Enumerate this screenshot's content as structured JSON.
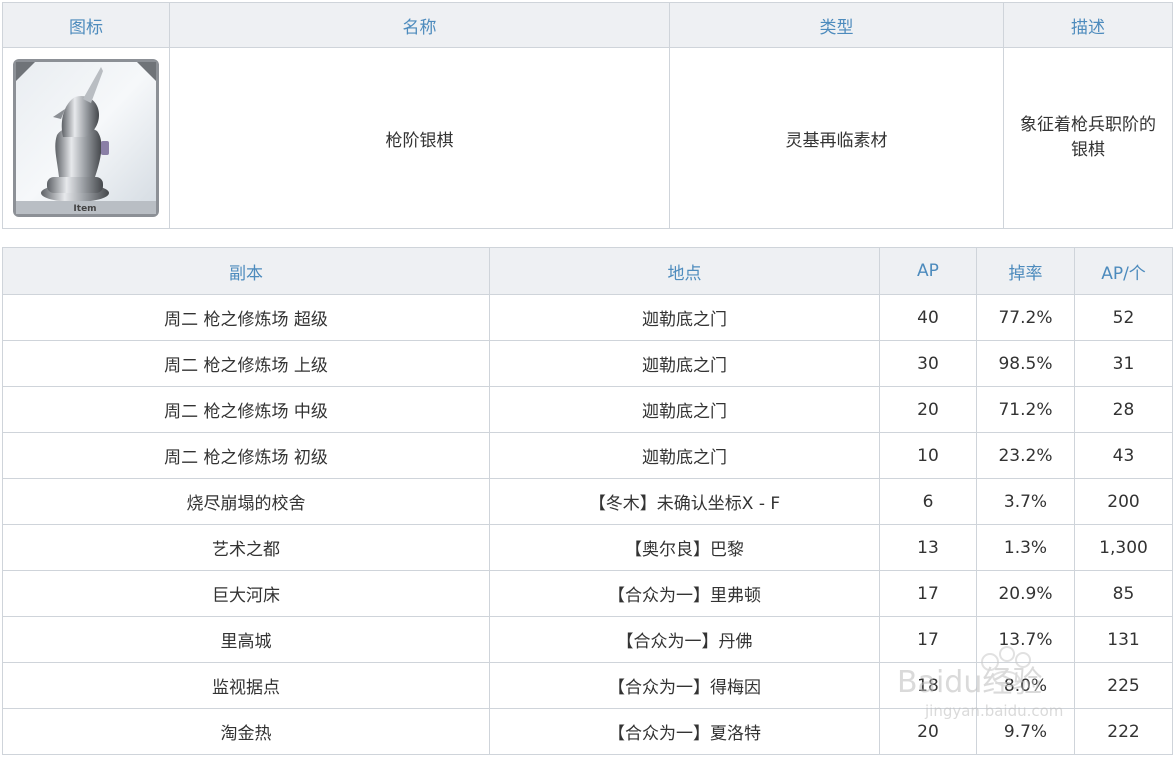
{
  "item_table": {
    "headers": [
      "图标",
      "名称",
      "类型",
      "描述"
    ],
    "item": {
      "icon_name": "silver-lancer-piece-icon",
      "icon_label": "Item",
      "name": "枪阶银棋",
      "type": "灵基再临素材",
      "description": "象征着枪兵职阶的银棋"
    }
  },
  "drop_table": {
    "headers": [
      "副本",
      "地点",
      "AP",
      "掉率",
      "AP/个"
    ],
    "rows": [
      [
        "周二 枪之修炼场 超级",
        "迦勒底之门",
        "40",
        "77.2%",
        "52"
      ],
      [
        "周二 枪之修炼场 上级",
        "迦勒底之门",
        "30",
        "98.5%",
        "31"
      ],
      [
        "周二 枪之修炼场 中级",
        "迦勒底之门",
        "20",
        "71.2%",
        "28"
      ],
      [
        "周二 枪之修炼场 初级",
        "迦勒底之门",
        "10",
        "23.2%",
        "43"
      ],
      [
        "烧尽崩塌的校舍",
        "【冬木】未确认坐标X - F",
        "6",
        "3.7%",
        "200"
      ],
      [
        "艺术之都",
        "【奥尔良】巴黎",
        "13",
        "1.3%",
        "1,300"
      ],
      [
        "巨大河床",
        "【合众为一】里弗顿",
        "17",
        "20.9%",
        "85"
      ],
      [
        "里高城",
        "【合众为一】丹佛",
        "17",
        "13.7%",
        "131"
      ],
      [
        "监视据点",
        "【合众为一】得梅因",
        "18",
        "8.0%",
        "225"
      ],
      [
        "淘金热",
        "【合众为一】夏洛特",
        "20",
        "9.7%",
        "222"
      ]
    ]
  },
  "watermark": {
    "logo": "Baidu经验",
    "url": "jingyan.baidu.com"
  }
}
